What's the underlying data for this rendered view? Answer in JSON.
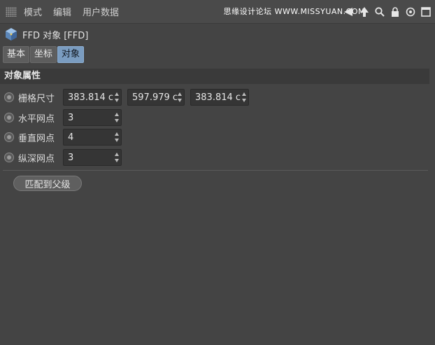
{
  "menu": {
    "items": [
      "模式",
      "编辑",
      "用户数据"
    ],
    "watermark": "思缘设计论坛 WWW.MISSYUAN.COM"
  },
  "object": {
    "title": "FFD 对象 [FFD]",
    "icon": "ffd-cube-icon"
  },
  "tabs": [
    {
      "label": "基本",
      "active": false
    },
    {
      "label": "坐标",
      "active": false
    },
    {
      "label": "对象",
      "active": true
    }
  ],
  "section": {
    "title": "对象属性"
  },
  "properties": {
    "grid_size": {
      "label": "栅格尺寸",
      "values": [
        "383.814 c",
        "597.979 c",
        "383.814 c"
      ]
    },
    "h_points": {
      "label": "水平网点",
      "value": "3"
    },
    "v_points": {
      "label": "垂直网点",
      "value": "4"
    },
    "d_points": {
      "label": "纵深网点",
      "value": "3"
    }
  },
  "actions": {
    "match_parent": "匹配到父级"
  },
  "colors": {
    "background": "#444444",
    "active_tab": "#7a9cc0",
    "section_bar": "#3a3a3a",
    "field": "#353535"
  }
}
